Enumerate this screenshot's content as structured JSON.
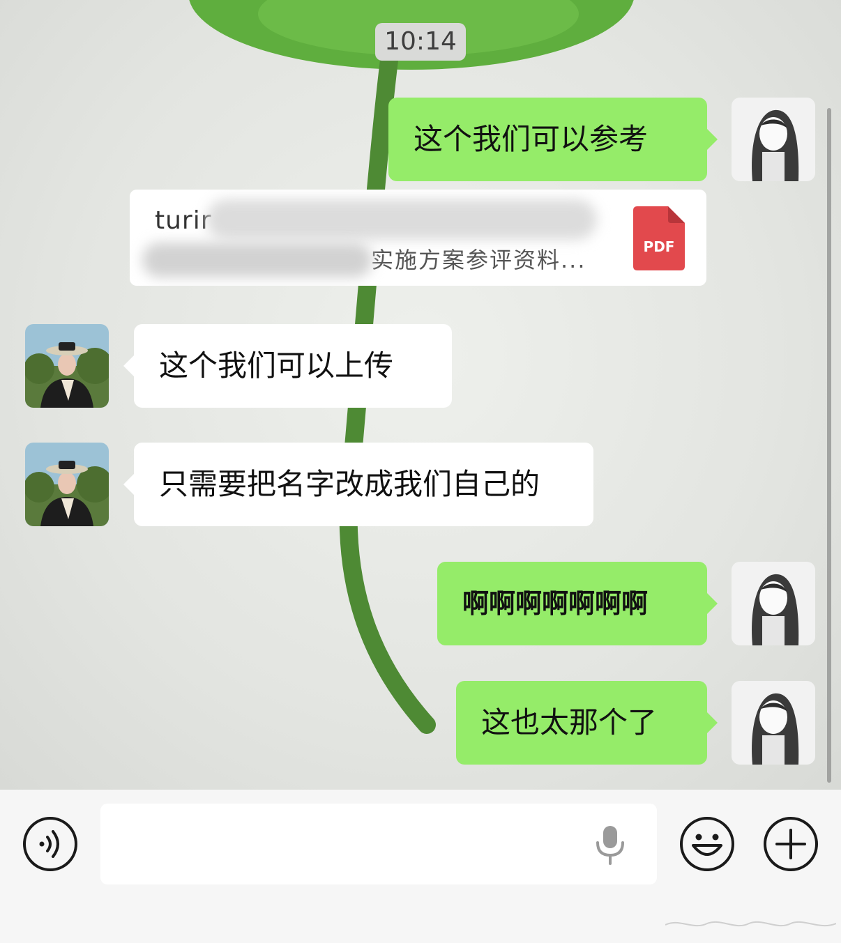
{
  "timestamp": "10:14",
  "messages": [
    {
      "sender": "me",
      "type": "text",
      "text": "这个我们可以参考"
    },
    {
      "sender": "me",
      "type": "file",
      "file_name_line1": "turir",
      "file_name_line2": "实施方案参评资料...",
      "file_type": "PDF"
    },
    {
      "sender": "other",
      "type": "text",
      "text": "这个我们可以上传"
    },
    {
      "sender": "other",
      "type": "text",
      "text": "只需要把名字改成我们自己的"
    },
    {
      "sender": "me",
      "type": "text",
      "text": "啊啊啊啊啊啊啊"
    },
    {
      "sender": "me",
      "type": "text",
      "text": "这也太那个了"
    }
  ],
  "input_bar": {
    "voice_toggle_icon": "voice-wave-icon",
    "mic_icon": "microphone-icon",
    "emoji_icon": "smiley-icon",
    "more_icon": "plus-circle-icon"
  },
  "colors": {
    "my_bubble": "#95ec69",
    "other_bubble": "#ffffff",
    "pdf_icon": "#e2494d",
    "bottom_bar": "#f6f6f6"
  }
}
